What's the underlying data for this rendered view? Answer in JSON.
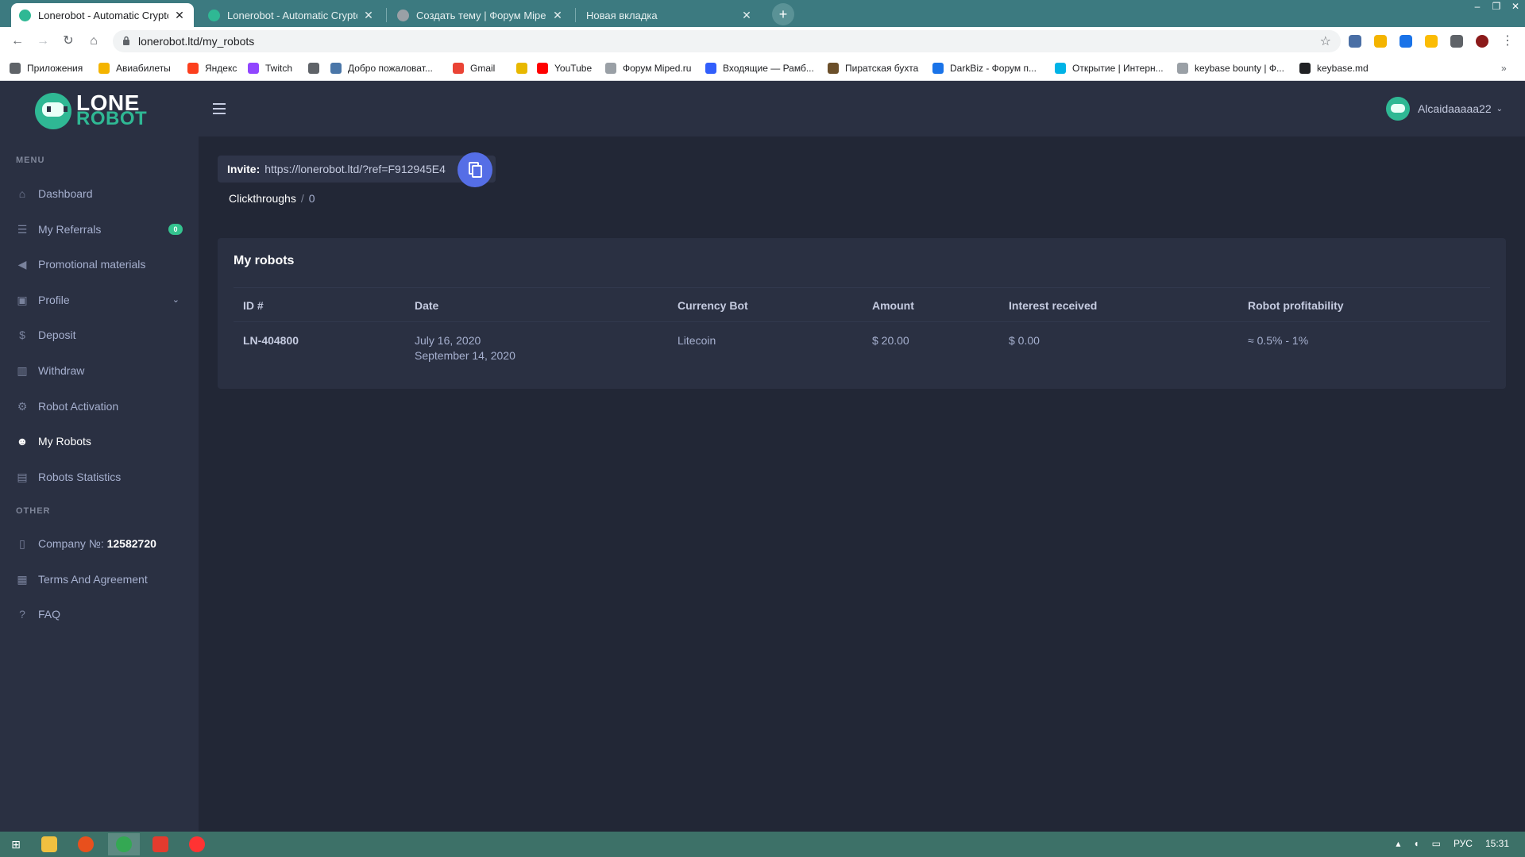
{
  "browser": {
    "tabs": [
      {
        "title": "Lonerobot - Automatic Cryptocurrency",
        "active": true
      },
      {
        "title": "Lonerobot - Automatic Cryptocurrency",
        "active": false
      },
      {
        "title": "Создать тему | Форум Miped.ru",
        "active": false
      },
      {
        "title": "Новая вкладка",
        "active": false
      }
    ],
    "close_glyph": "✕",
    "new_tab_glyph": "+",
    "url": "lonerobot.ltd/my_robots",
    "bookmarks": [
      {
        "label": "Приложения",
        "color": "#5f6368"
      },
      {
        "label": "Авиабилеты",
        "color": "#f4b400"
      },
      {
        "label": "Яндекс",
        "color": "#fc3f1d"
      },
      {
        "label": "Twitch",
        "color": "#9146ff"
      },
      {
        "label": "",
        "color": "#5f6368"
      },
      {
        "label": "Добро пожаловат...",
        "color": "#4a76a8"
      },
      {
        "label": "Gmail",
        "color": "#ea4335"
      },
      {
        "label": "",
        "color": "#e8b800"
      },
      {
        "label": "YouTube",
        "color": "#ff0000"
      },
      {
        "label": "Форум Miped.ru",
        "color": "#9aa0a6"
      },
      {
        "label": "Входящие — Рамб...",
        "color": "#315efb"
      },
      {
        "label": "Пиратская бухта",
        "color": "#6b4f2a"
      },
      {
        "label": "DarkBiz - Форум п...",
        "color": "#1a73e8"
      },
      {
        "label": "Открытие | Интерн...",
        "color": "#00b3e6"
      },
      {
        "label": "keybase bounty | Ф...",
        "color": "#9aa0a6"
      },
      {
        "label": "keybase.md",
        "color": "#202124"
      }
    ],
    "more_glyph": "»"
  },
  "app": {
    "logo": {
      "line1": "LONE",
      "line2": "ROBOT"
    },
    "menu_title": "MENU",
    "other_title": "OTHER",
    "menu": [
      {
        "label": "Dashboard",
        "icon": "home-icon",
        "glyph": "⌂"
      },
      {
        "label": "My Referrals",
        "icon": "users-icon",
        "glyph": "☰",
        "badge": "0"
      },
      {
        "label": "Promotional materials",
        "icon": "megaphone-icon",
        "glyph": "◀"
      },
      {
        "label": "Profile",
        "icon": "briefcase-icon",
        "glyph": "▣",
        "chevron": "⌄"
      },
      {
        "label": "Deposit",
        "icon": "dollar-icon",
        "glyph": "$"
      },
      {
        "label": "Withdraw",
        "icon": "bank-icon",
        "glyph": "▥"
      },
      {
        "label": "Robot Activation",
        "icon": "cog-icon",
        "glyph": "⚙"
      },
      {
        "label": "My Robots",
        "icon": "robot-icon",
        "glyph": "☻",
        "active": true
      },
      {
        "label": "Robots Statistics",
        "icon": "bar-chart-icon",
        "glyph": "▤"
      }
    ],
    "other": [
      {
        "label": "Company №: ",
        "bold": "12582720",
        "icon": "document-icon",
        "glyph": "▯"
      },
      {
        "label": "Terms And Agreement",
        "icon": "book-icon",
        "glyph": "▦"
      },
      {
        "label": "FAQ",
        "icon": "question-icon",
        "glyph": "?"
      }
    ],
    "user": {
      "name": "Alcaidaaaaa22",
      "caret": "⌄"
    },
    "invite": {
      "label": "Invite:",
      "url": "https://lonerobot.ltd/?ref=F912945E4"
    },
    "clickthroughs": {
      "label": "Clickthroughs",
      "sep": "/",
      "value": "0"
    },
    "robots": {
      "title": "My robots",
      "columns": [
        "ID #",
        "Date",
        "Currency Bot",
        "Amount",
        "Interest received",
        "Robot profitability"
      ],
      "rows": [
        {
          "id": "LN-404800",
          "date_start": "July 16, 2020",
          "date_end": "September 14, 2020",
          "currency": "Litecoin",
          "amount": "$ 20.00",
          "interest": "$ 0.00",
          "profitability": "≈ 0.5% - 1%"
        }
      ]
    }
  },
  "taskbar": {
    "tray": {
      "lang": "РУС",
      "time": "15:31"
    }
  },
  "colors": {
    "accent": "#556ee6",
    "brand": "#2fb894",
    "badge": "#34c38f"
  }
}
